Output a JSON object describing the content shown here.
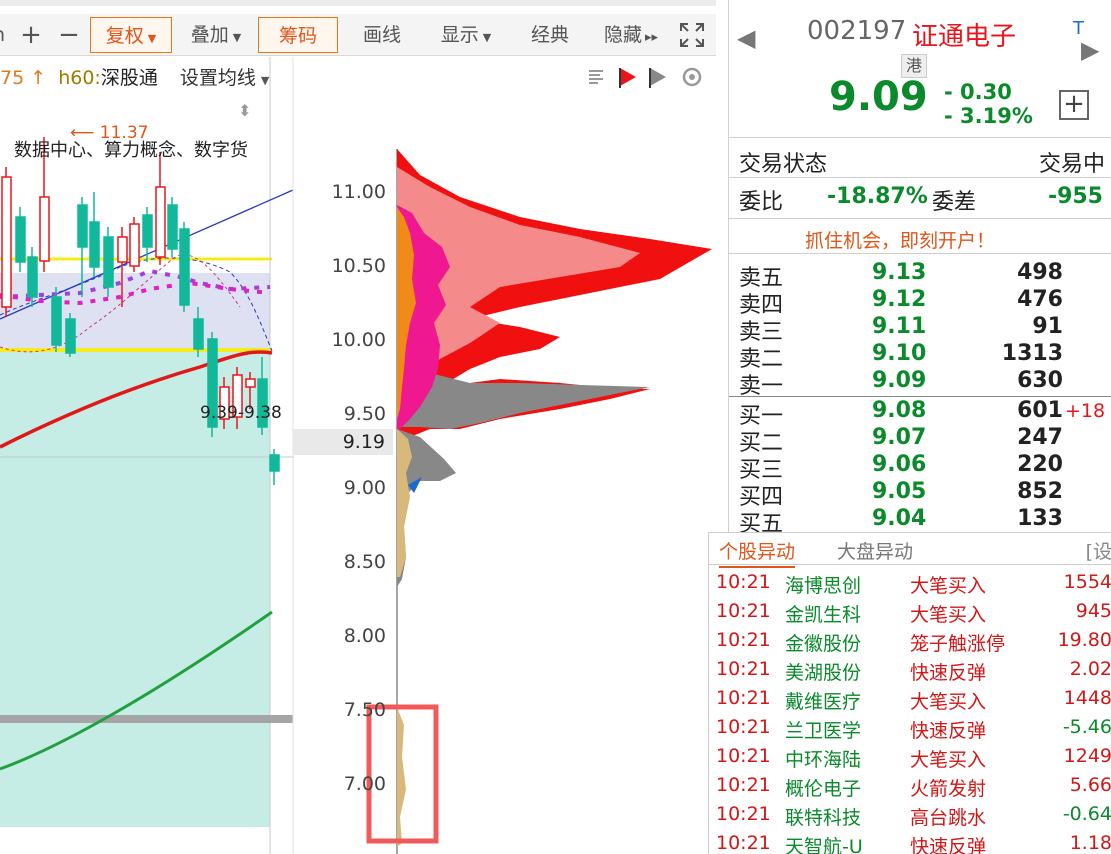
{
  "toolbar": {
    "items": [
      {
        "label": "复权",
        "boxed": true,
        "caret": true
      },
      {
        "label": "叠加",
        "boxed": false,
        "caret": true
      },
      {
        "label": "筹码",
        "boxed": true,
        "caret": false
      },
      {
        "label": "画线",
        "boxed": false,
        "caret": false
      },
      {
        "label": "显示",
        "boxed": false,
        "caret": true
      },
      {
        "label": "经典",
        "boxed": false,
        "caret": false
      },
      {
        "label": "隐藏",
        "boxed": false,
        "caret": false
      }
    ],
    "plus_label": "+",
    "minus_label": "−",
    "hide_arrows": "▸▸",
    "expand_icon": "expand-icon"
  },
  "chart": {
    "ma_prefix": "75",
    "ma_arrow": "↑",
    "ma_h60_label": "h60:",
    "ma_h60_value": "深股通",
    "ma_settings": "设置均线",
    "concept_text": "数据中心、算力概念、数字货",
    "high_label": "11.37",
    "low_label": "9.39-9.38",
    "current_price_tag": "9.19",
    "price_ticks": [
      "11.00",
      "10.50",
      "10.00",
      "9.50",
      "9.00",
      "8.50",
      "8.00",
      "7.50",
      "7.00"
    ],
    "colors": {
      "up": "#e8161c",
      "down": "#12b89a",
      "ma_red": "#e01818",
      "ma_green": "#22a040",
      "band_fill": "#dde1f2",
      "lower_fill": "#c6ece6",
      "yellow": "#f5ec1a",
      "chip_red": "#f01010",
      "chip_pink": "#f58a8a",
      "chip_magenta": "#f01890",
      "chip_orange": "#f08a18",
      "chip_gray": "#888888",
      "chip_tan": "#d9b97a",
      "highlight_box": "#f05a5a"
    }
  },
  "quote": {
    "code": "002197",
    "name": "证通电子",
    "t_mark": "T",
    "hk_tag": "港",
    "price": "9.09",
    "change": "- 0.30",
    "change_pct": "- 3.19%",
    "add_label": "+",
    "status_label": "交易状态",
    "status_value": "交易中",
    "weibi_label": "委比",
    "weibi_value": "-18.87%",
    "weicha_label": "委差",
    "weicha_value": "-955",
    "promo": "抓住机会，即刻开户！",
    "asks": [
      {
        "label": "卖五",
        "price": "9.13",
        "vol": "498"
      },
      {
        "label": "卖四",
        "price": "9.12",
        "vol": "476"
      },
      {
        "label": "卖三",
        "price": "9.11",
        "vol": "91"
      },
      {
        "label": "卖二",
        "price": "9.10",
        "vol": "1313"
      },
      {
        "label": "卖一",
        "price": "9.09",
        "vol": "630"
      }
    ],
    "bids": [
      {
        "label": "买一",
        "price": "9.08",
        "vol": "601",
        "delta": "+18"
      },
      {
        "label": "买二",
        "price": "9.07",
        "vol": "247",
        "delta": ""
      },
      {
        "label": "买三",
        "price": "9.06",
        "vol": "220",
        "delta": ""
      },
      {
        "label": "买四",
        "price": "9.05",
        "vol": "852",
        "delta": ""
      },
      {
        "label": "买五",
        "price": "9.04",
        "vol": "133",
        "delta": ""
      }
    ]
  },
  "alerts": {
    "tab_active": "个股异动",
    "tab_inactive": "大盘异动",
    "settings": "[设",
    "rows": [
      {
        "time": "10:21",
        "name": "海博思创",
        "type": "大笔买入",
        "value": "1554",
        "name_color": "#0a8a2a"
      },
      {
        "time": "10:21",
        "name": "金凯生科",
        "type": "大笔买入",
        "value": "945",
        "name_color": "#0a8a2a"
      },
      {
        "time": "10:21",
        "name": "金徽股份",
        "type": "笼子触涨停",
        "value": "19.80",
        "name_color": "#0a8a2a"
      },
      {
        "time": "10:21",
        "name": "美湖股份",
        "type": "快速反弹",
        "value": "2.02",
        "name_color": "#0a8a2a"
      },
      {
        "time": "10:21",
        "name": "戴维医疗",
        "type": "大笔买入",
        "value": "1448",
        "name_color": "#0a8a2a"
      },
      {
        "time": "10:21",
        "name": "兰卫医学",
        "type": "快速反弹",
        "value": "-5.46",
        "name_color": "#0a8a2a"
      },
      {
        "time": "10:21",
        "name": "中环海陆",
        "type": "大笔买入",
        "value": "1249",
        "name_color": "#0a8a2a"
      },
      {
        "time": "10:21",
        "name": "概伦电子",
        "type": "火箭发射",
        "value": "5.66",
        "name_color": "#0a8a2a"
      },
      {
        "time": "10:21",
        "name": "联特科技",
        "type": "高台跳水",
        "value": "-0.64",
        "name_color": "#0a8a2a"
      },
      {
        "time": "10:21",
        "name": "天智航-U",
        "type": "快速反弹",
        "value": "1.18",
        "name_color": "#0a8a2a"
      }
    ]
  }
}
